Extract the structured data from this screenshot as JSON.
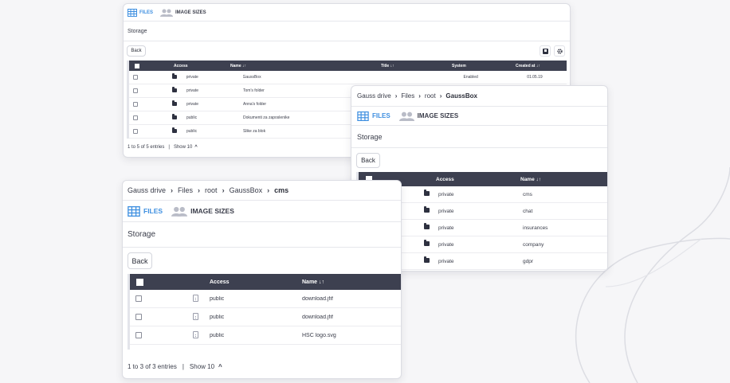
{
  "panel_a": {
    "tabs": {
      "files": "FILES",
      "image_sizes": "IMAGE SIZES"
    },
    "storage_label": "Storage",
    "back_label": "Back",
    "columns": {
      "access": "Access",
      "name": "Name ↓↑",
      "title": "Title ↓↑",
      "system": "System",
      "created": "Created at ↓↑"
    },
    "rows": [
      {
        "access": "private",
        "name": "GaussBox",
        "system": "Enabled",
        "created": "01.05.19"
      },
      {
        "access": "private",
        "name": "Tom's folder",
        "system": "",
        "created": ""
      },
      {
        "access": "private",
        "name": "Anna's folder",
        "system": "",
        "created": ""
      },
      {
        "access": "public",
        "name": "Dokumenti za zaposlenike",
        "system": "",
        "created": ""
      },
      {
        "access": "public",
        "name": "Slike za blok",
        "system": "",
        "created": ""
      }
    ],
    "footer": {
      "entries": "1 to 5 of 5 entries",
      "separator": "|",
      "show": "Show 10"
    }
  },
  "panel_b": {
    "breadcrumb": [
      "Gauss drive",
      "Files",
      "root",
      "GaussBox"
    ],
    "tabs": {
      "files": "FILES",
      "image_sizes": "IMAGE SIZES"
    },
    "storage_label": "Storage",
    "back_label": "Back",
    "columns": {
      "access": "Access",
      "name": "Name ↓↑"
    },
    "rows": [
      {
        "access": "private",
        "name": "cms"
      },
      {
        "access": "private",
        "name": "chat"
      },
      {
        "access": "private",
        "name": "insurances"
      },
      {
        "access": "private",
        "name": "company"
      },
      {
        "access": "private",
        "name": "gdpr"
      }
    ]
  },
  "panel_c": {
    "breadcrumb": [
      "Gauss drive",
      "Files",
      "root",
      "GaussBox",
      "cms"
    ],
    "tabs": {
      "files": "FILES",
      "image_sizes": "IMAGE SIZES"
    },
    "storage_label": "Storage",
    "back_label": "Back",
    "columns": {
      "access": "Access",
      "name": "Name ↓↑"
    },
    "rows": [
      {
        "access": "public",
        "name": "download.jfif"
      },
      {
        "access": "public",
        "name": "download.jfif"
      },
      {
        "access": "public",
        "name": "HSC logo.svg"
      }
    ],
    "footer": {
      "entries": "1 to 3 of 3 entries",
      "separator": "|",
      "show": "Show 10"
    }
  },
  "breadcrumb_separator": "›",
  "chevron_up": "^",
  "icons": {
    "files_tab": "grid-table-icon",
    "image_sizes_tab": "users-icon",
    "folder": "folder-icon",
    "file": "file-icon",
    "download": "download-icon",
    "settings": "gear-icon"
  },
  "colors": {
    "accent": "#3e8fe0",
    "header": "#3d4050",
    "background": "#f6f6f8"
  }
}
